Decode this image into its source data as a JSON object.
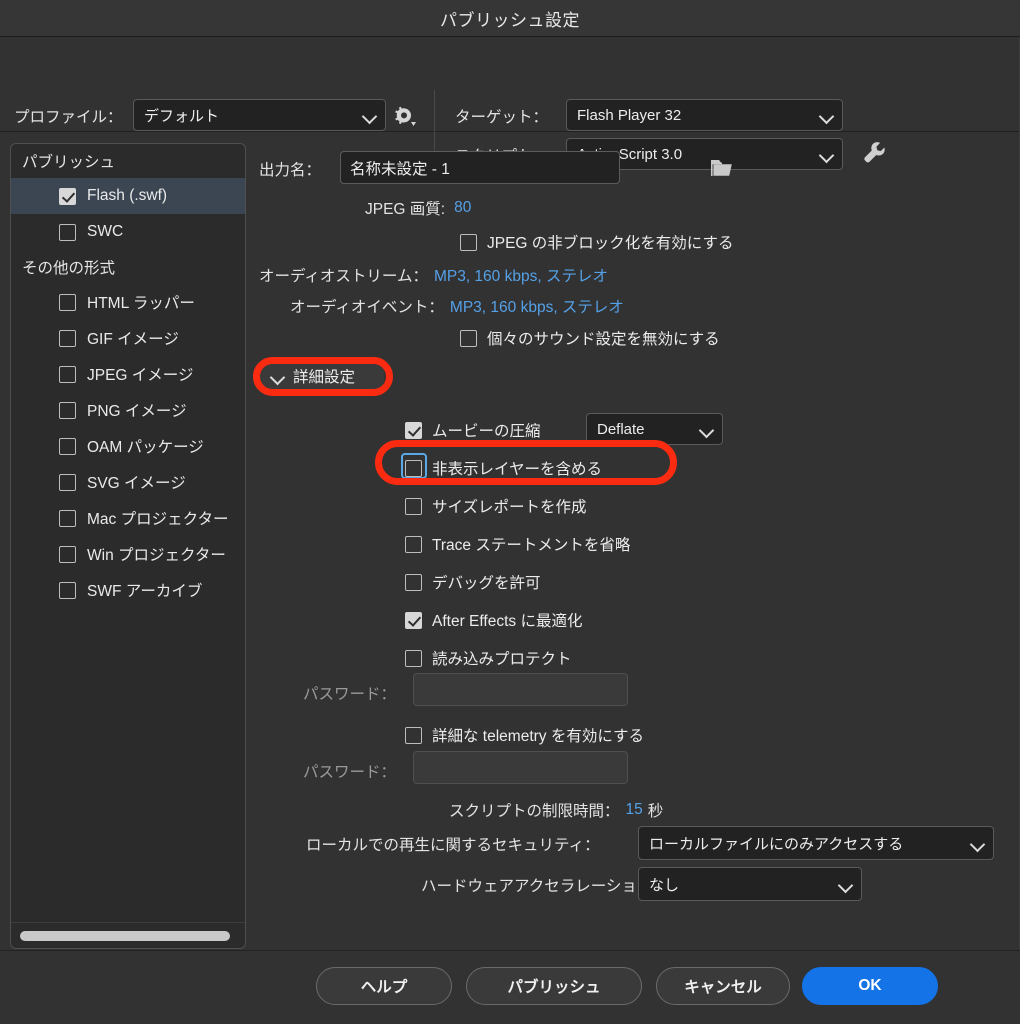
{
  "window": {
    "title": "パブリッシュ設定"
  },
  "topbar": {
    "profile_label": "プロファイル：",
    "profile_value": "デフォルト",
    "gear_icon": "gear-icon",
    "target_label": "ターゲット：",
    "target_value": "Flash Player 32",
    "script_label": "スクリプト：",
    "script_value": "ActionScript 3.0",
    "wrench_icon": "wrench-icon"
  },
  "sidebar": {
    "group_publish": "パブリッシュ",
    "group_other": "その他の形式",
    "publish_items": [
      {
        "label": "Flash (.swf)",
        "checked": true,
        "selected": true
      },
      {
        "label": "SWC",
        "checked": false,
        "selected": false
      }
    ],
    "other_items": [
      {
        "label": "HTML ラッパー",
        "checked": false
      },
      {
        "label": "GIF イメージ",
        "checked": false
      },
      {
        "label": "JPEG イメージ",
        "checked": false
      },
      {
        "label": "PNG イメージ",
        "checked": false
      },
      {
        "label": "OAM パッケージ",
        "checked": false
      },
      {
        "label": "SVG イメージ",
        "checked": false
      },
      {
        "label": "Mac プロジェクター",
        "checked": false
      },
      {
        "label": "Win プロジェクター",
        "checked": false
      },
      {
        "label": "SWF アーカイブ",
        "checked": false
      }
    ]
  },
  "main": {
    "output_label": "出力名：",
    "output_value": "名称未設定 - 1",
    "folder_icon": "folder-icon",
    "jpeg_quality_label": "JPEG 画質:",
    "jpeg_quality_value": "80",
    "jpeg_deblock_label": "JPEG の非ブロック化を有効にする",
    "jpeg_deblock_checked": false,
    "audio_stream_label": "オーディオストリーム：",
    "audio_stream_value": "MP3, 160 kbps, ステレオ",
    "audio_event_label": "オーディオイベント：",
    "audio_event_value": "MP3, 160 kbps, ステレオ",
    "override_sound_label": "個々のサウンド設定を無効にする",
    "override_sound_checked": false,
    "advanced_label": "詳細設定",
    "compress_movie_label": "ムービーの圧縮",
    "compress_movie_checked": true,
    "compress_method_value": "Deflate",
    "include_hidden_label": "非表示レイヤーを含める",
    "include_hidden_checked": false,
    "size_report_label": "サイズレポートを作成",
    "size_report_checked": false,
    "omit_trace_label": "Trace ステートメントを省略",
    "omit_trace_checked": false,
    "permit_debug_label": "デバッグを許可",
    "permit_debug_checked": false,
    "optimize_ae_label": "After Effects に最適化",
    "optimize_ae_checked": true,
    "protect_import_label": "読み込みプロテクト",
    "protect_import_checked": false,
    "password1_label": "パスワード：",
    "password1_value": "",
    "telemetry_label": "詳細な telemetry を有効にする",
    "telemetry_checked": false,
    "password2_label": "パスワード：",
    "password2_value": "",
    "script_limit_label": "スクリプトの制限時間：",
    "script_limit_value": "15",
    "script_limit_unit": "秒",
    "local_security_label": "ローカルでの再生に関するセキュリティ：",
    "local_security_value": "ローカルファイルにのみアクセスする",
    "hw_accel_label": "ハードウェアアクセラレーション：",
    "hw_accel_value": "なし"
  },
  "footer": {
    "help": "ヘルプ",
    "publish": "パブリッシュ",
    "cancel": "キャンセル",
    "ok": "OK"
  },
  "colors": {
    "accent_blue": "#1473e6",
    "link_blue": "#55a1e8",
    "annotation_red": "#fb2b11",
    "selection": "#3c4653"
  }
}
